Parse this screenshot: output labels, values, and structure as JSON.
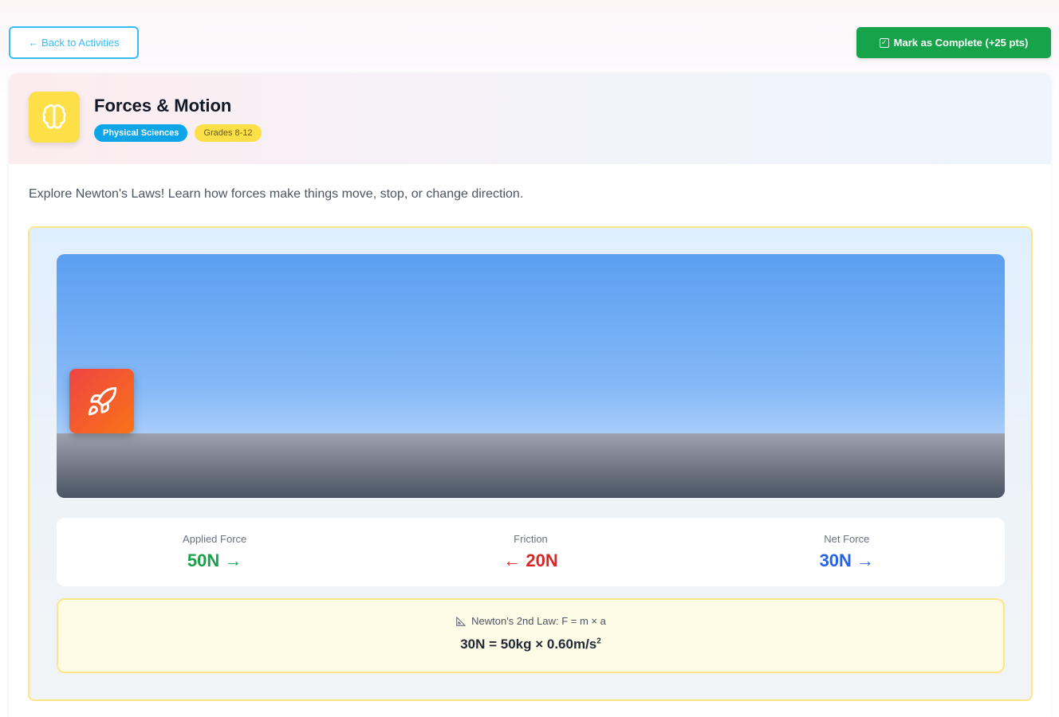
{
  "top_bar": {
    "back_label": "← Back to Activities",
    "complete_label": "Mark as Complete (+25 pts)"
  },
  "activity": {
    "title": "Forces & Motion",
    "icon": "brain-icon",
    "subject_tag": "Physical Sciences",
    "grade_tag": "Grades 8-12",
    "description": "Explore Newton's Laws! Learn how forces make things move, stop, or change direction."
  },
  "simulation": {
    "object_icon": "rocket-icon",
    "forces": [
      {
        "label": "Applied Force",
        "value": "50N →",
        "color": "#16a34a"
      },
      {
        "label": "Friction",
        "value": "← 20N",
        "color": "#dc2626"
      },
      {
        "label": "Net Force",
        "value": "30N →",
        "color": "#2563eb"
      }
    ],
    "law": {
      "title": "Newton's 2nd Law: F = m × a",
      "equation": "30N = 50kg × 0.60m/s",
      "equation_sup": "2"
    }
  },
  "colors": {
    "accent_blue": "#38bdf8",
    "complete_green": "#16a34a",
    "icon_yellow": "#fde047"
  }
}
